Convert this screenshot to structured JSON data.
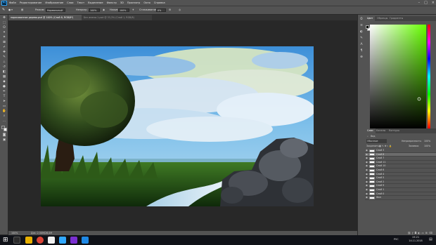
{
  "menu": {
    "items": [
      "Файл",
      "Редактирование",
      "Изображение",
      "Слои",
      "Текст",
      "Выделение",
      "Фильтр",
      "3D",
      "Просмотр",
      "Окно",
      "Справка"
    ]
  },
  "options": {
    "mode_label": "Режим:",
    "mode_value": "Нормальный",
    "opacity_label": "Непрозр.:",
    "opacity_value": "100%",
    "flow_label": "Нажим:",
    "flow_value": "100%",
    "smoothing_label": "Сглаживание:",
    "smoothing_value": "0%"
  },
  "tabs": [
    {
      "label": "нарисованное дерево.psd @ 100% (Слой 8, RGB/8*)"
    },
    {
      "label": "Без имени-1.psd @ 33,3% (Слой 1, RGB/8)"
    }
  ],
  "status": {
    "zoom": "100%",
    "doc": "Док: 2,50M/26,0M"
  },
  "color_panel": {
    "tabs": [
      "Цвет",
      "Образцы",
      "Градиенты"
    ],
    "hue_color": "#66ff00",
    "fg_color": "#0a0f08",
    "bg_color": "#ffffff"
  },
  "layers_panel": {
    "tabs": [
      "Слои",
      "Каналы",
      "Контуры"
    ],
    "filter_label": "Вид",
    "blend": "Обычные",
    "opacity_label": "Непрозрачность:",
    "opacity_value": "100%",
    "lock_label": "Закрепить:",
    "fill_label": "Заливка:",
    "fill_value": "100%",
    "layers": [
      {
        "name": "Слой 3",
        "selected": false
      },
      {
        "name": "Слой 8",
        "selected": true
      },
      {
        "name": "Слой 7",
        "selected": false
      },
      {
        "name": "Слой 11",
        "selected": false
      },
      {
        "name": "Слой 10",
        "selected": false
      },
      {
        "name": "Слой 6",
        "selected": false
      },
      {
        "name": "Слой 4",
        "selected": false
      },
      {
        "name": "Слой 5",
        "selected": false
      },
      {
        "name": "Слой 2",
        "selected": false
      },
      {
        "name": "Слой 9",
        "selected": false
      },
      {
        "name": "Слой 1",
        "selected": false
      },
      {
        "name": "Слой 0",
        "selected": false
      },
      {
        "name": "Фон",
        "selected": false
      }
    ]
  },
  "taskbar": {
    "lang": "РУС",
    "time": "19:21",
    "date": "14.11.2018"
  }
}
